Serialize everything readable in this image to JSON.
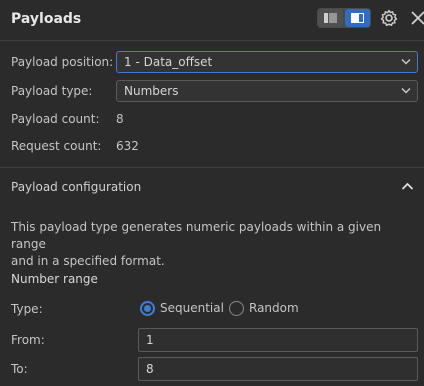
{
  "panel": {
    "title": "Payloads"
  },
  "fields": {
    "position_label": "Payload position:",
    "position_value": "1 - Data_offset",
    "type_label": "Payload type:",
    "type_value": "Numbers",
    "count_label": "Payload count:",
    "count_value": "8",
    "request_label": "Request count:",
    "request_value": "632"
  },
  "config": {
    "title": "Payload configuration",
    "description_line1": "This payload type generates numeric payloads within a given range",
    "description_line2": "and in a specified format.",
    "range_title": "Number range",
    "type_label": "Type:",
    "option_sequential": "Sequential",
    "option_random": "Random",
    "selected_option": "Sequential",
    "from_label": "From:",
    "from_value": "1",
    "to_label": "To:",
    "to_value": "8"
  },
  "icons": {
    "layout_left": "list-layout-icon",
    "layout_right": "split-layout-icon",
    "settings": "gear-icon",
    "close": "close-icon",
    "collapse": "chevron-up-icon"
  },
  "colors": {
    "accent": "#3d7dd8",
    "background": "#2b2b2b"
  }
}
